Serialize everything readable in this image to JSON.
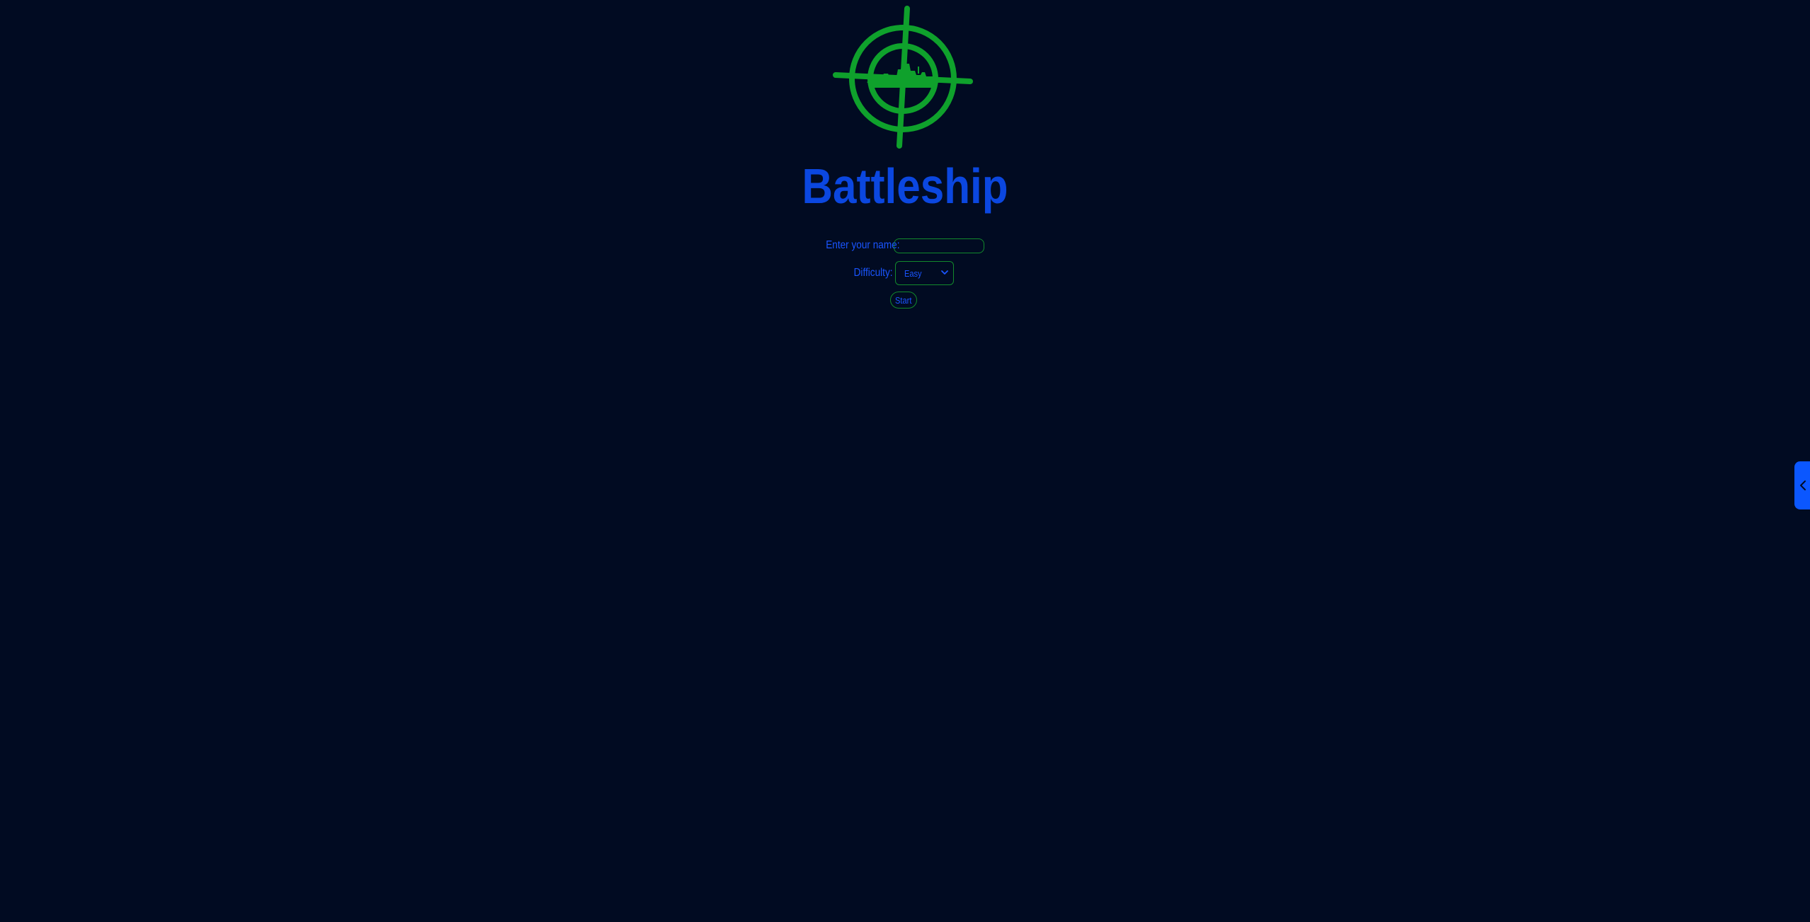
{
  "app": {
    "title": "Battleship",
    "logo_icon": "crosshair-battleship-logo-icon"
  },
  "form": {
    "name_label": "Enter your name:",
    "name_value": "",
    "name_placeholder": "",
    "difficulty_label": "Difficulty:",
    "difficulty_selected": "Easy",
    "start_label": "Start"
  },
  "side_panel": {
    "toggle_icon": "chevron-left-icon"
  },
  "colors": {
    "background": "#010b22",
    "accent_blue": "#0b47e0",
    "label_blue": "#1a55ff",
    "border_green": "#128a2c",
    "logo_green": "#0fa12c",
    "side_tab_blue": "#0b57ff"
  }
}
